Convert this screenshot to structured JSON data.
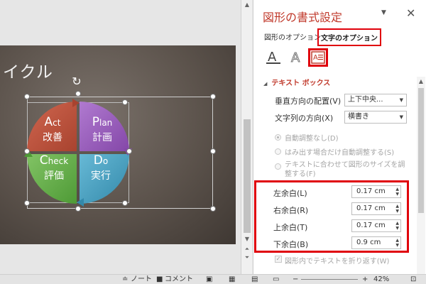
{
  "slide": {
    "title_partial": "イクル",
    "quadrants": [
      {
        "id": "act",
        "big": "A",
        "small": "ct",
        "jp": "改善",
        "color": "#c0533f"
      },
      {
        "id": "plan",
        "big": "P",
        "small": "lan",
        "jp": "計画",
        "color": "#9b59b6"
      },
      {
        "id": "check",
        "big": "C",
        "small": "heck",
        "jp": "評価",
        "color": "#6ab04c"
      },
      {
        "id": "do",
        "big": "D",
        "small": "o",
        "jp": "実行",
        "color": "#4aa3c4"
      }
    ]
  },
  "panel": {
    "title": "図形の書式設定",
    "tabs": {
      "shape": "図形のオプション",
      "text": "文字のオプション"
    },
    "section": "テキスト ボックス",
    "vertical_align": {
      "label": "垂直方向の配置(V)",
      "value": "上下中央..."
    },
    "text_direction": {
      "label": "文字列の方向(X)",
      "value": "横書き"
    },
    "autofit": [
      {
        "label": "自動調整なし(D)",
        "selected": true
      },
      {
        "label": "はみ出す場合だけ自動調整する(S)",
        "selected": false
      },
      {
        "label": "テキストに合わせて図形のサイズを調整する(F)",
        "selected": false
      }
    ],
    "margins": [
      {
        "label": "左余白(L)",
        "value": "0.17 cm"
      },
      {
        "label": "右余白(R)",
        "value": "0.17 cm"
      },
      {
        "label": "上余白(T)",
        "value": "0.17 cm"
      },
      {
        "label": "下余白(B)",
        "value": "0.9 cm"
      }
    ],
    "wrap": {
      "label": "図形内でテキストを折り返す(W)",
      "checked": true
    },
    "accent_color": "#c0392b",
    "highlight_color": "#e0000b"
  },
  "status": {
    "notes": "ノート",
    "comments": "コメント",
    "zoom": "42%"
  }
}
